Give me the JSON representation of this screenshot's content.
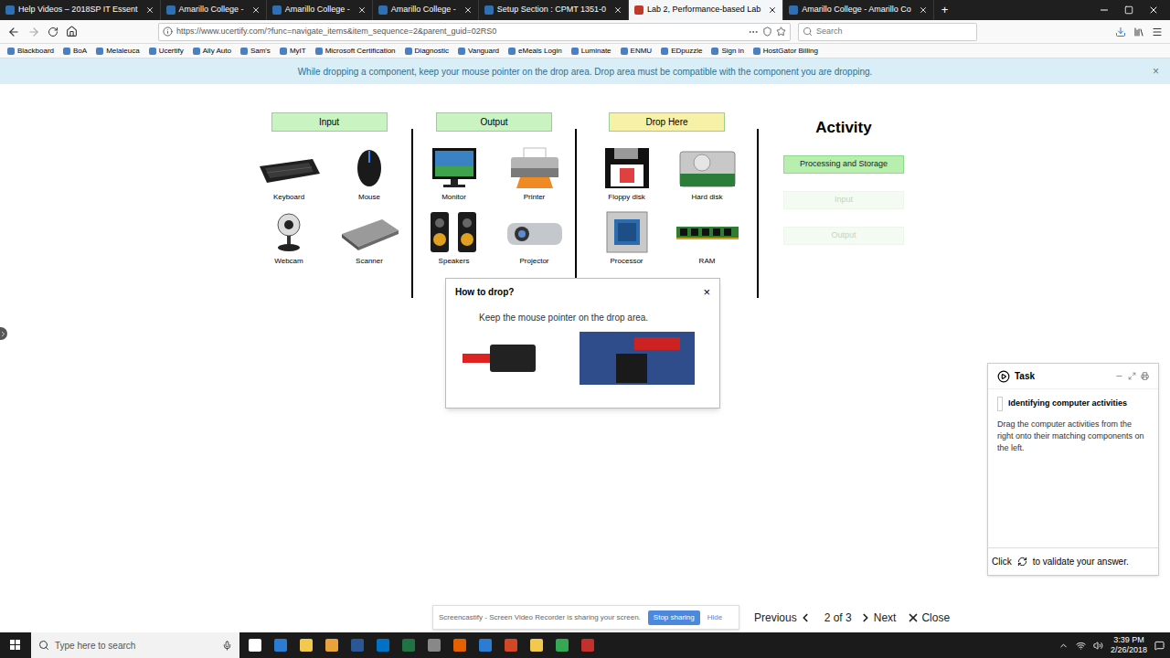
{
  "browser": {
    "tabs": [
      {
        "label": "Help Videos – 2018SP IT Essent",
        "selected": false
      },
      {
        "label": "Amarillo College -",
        "selected": false
      },
      {
        "label": "Amarillo College -",
        "selected": false
      },
      {
        "label": "Amarillo College -",
        "selected": false
      },
      {
        "label": "Setup Section : CPMT 1351-0",
        "selected": false
      },
      {
        "label": "Lab 2, Performance-based Lab",
        "selected": true
      },
      {
        "label": "Amarillo College - Amarillo Co",
        "selected": false
      }
    ],
    "new_tab": "+",
    "url": "https://www.ucertify.com/?func=navigate_items&item_sequence=2&parent_guid=02RS0",
    "search_placeholder": "Search",
    "bookmarks": [
      "Blackboard",
      "BoA",
      "Melaleuca",
      "Ucertify",
      "Ally Auto",
      "Sam's",
      "MyIT",
      "Microsoft Certification",
      "Diagnostic",
      "Vanguard",
      "eMeals Login",
      "Luminate",
      "ENMU",
      "EDpuzzle",
      "Sign in",
      "HostGator Billing"
    ]
  },
  "banner": {
    "text": "While dropping a component, keep your mouse pointer on the drop area. Drop area must be compatible with the component you are dropping.",
    "close": "×"
  },
  "columns": [
    {
      "title": "Input",
      "color": "#c9f3c1",
      "items": [
        {
          "label": "Keyboard",
          "kind": "keyboard"
        },
        {
          "label": "Mouse",
          "kind": "mouse"
        },
        {
          "label": "Webcam",
          "kind": "webcam"
        },
        {
          "label": "Scanner",
          "kind": "scanner"
        }
      ]
    },
    {
      "title": "Output",
      "color": "#c9f3c1",
      "items": [
        {
          "label": "Monitor",
          "kind": "monitor"
        },
        {
          "label": "Printer",
          "kind": "printer"
        },
        {
          "label": "Speakers",
          "kind": "speakers"
        },
        {
          "label": "Projector",
          "kind": "projector"
        }
      ]
    },
    {
      "title": "Drop Here",
      "color": "#f6f1a6",
      "items": [
        {
          "label": "Floppy disk",
          "kind": "floppy-disk"
        },
        {
          "label": "Hard disk",
          "kind": "hard-disk"
        },
        {
          "label": "Processor",
          "kind": "processor"
        },
        {
          "label": "RAM",
          "kind": "ram"
        }
      ]
    }
  ],
  "activity": {
    "title": "Activity",
    "buttons": [
      {
        "label": "Processing and Storage",
        "enabled": true
      },
      {
        "label": "Input",
        "enabled": false
      },
      {
        "label": "Output",
        "enabled": false
      }
    ]
  },
  "popup": {
    "title": "How to drop?",
    "close": "×",
    "text": "Keep the mouse pointer on the drop area."
  },
  "task": {
    "title": "Task",
    "heading": "Identifying computer activities",
    "body": "Drag the computer activities from the right onto their matching components on the left.",
    "footer_before": "Click",
    "footer_after": "to validate your answer."
  },
  "screencastify": {
    "text": "Screencastify - Screen Video Recorder is sharing your screen.",
    "stop": "Stop sharing",
    "hide": "Hide"
  },
  "navigation": {
    "previous": "Previous",
    "page": "2 of 3",
    "next": "Next",
    "close": "Close"
  },
  "taskbar": {
    "search_placeholder": "Type here to search",
    "time": "3:39 PM",
    "date": "2/26/2018"
  }
}
